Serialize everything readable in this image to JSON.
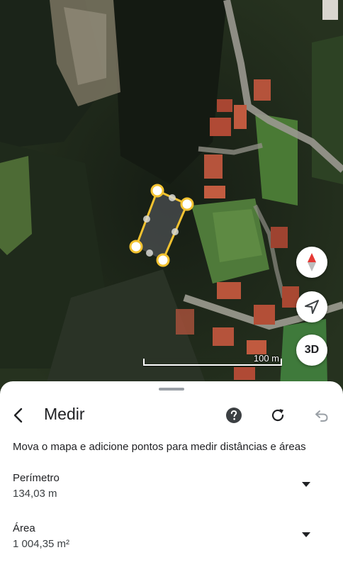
{
  "map": {
    "scale_label": "100 m",
    "mode_3d_label": "3D",
    "colors": {
      "measure_line": "#f2c230",
      "point_fill": "#ffffff",
      "compass_needle": "#e53935"
    }
  },
  "sheet": {
    "title": "Medir",
    "instruction": "Mova o mapa e adicione pontos para medir distâncias e áreas",
    "perimeter_label": "Perímetro",
    "perimeter_value": "134,03 m",
    "area_label": "Área",
    "area_value": "1 004,35 m²"
  },
  "icons": {
    "back": "back-arrow-icon",
    "help": "help-icon",
    "reset": "refresh-icon",
    "undo": "undo-icon",
    "compass": "compass-icon",
    "location": "navigation-arrow-icon",
    "expand": "caret-down-icon"
  }
}
